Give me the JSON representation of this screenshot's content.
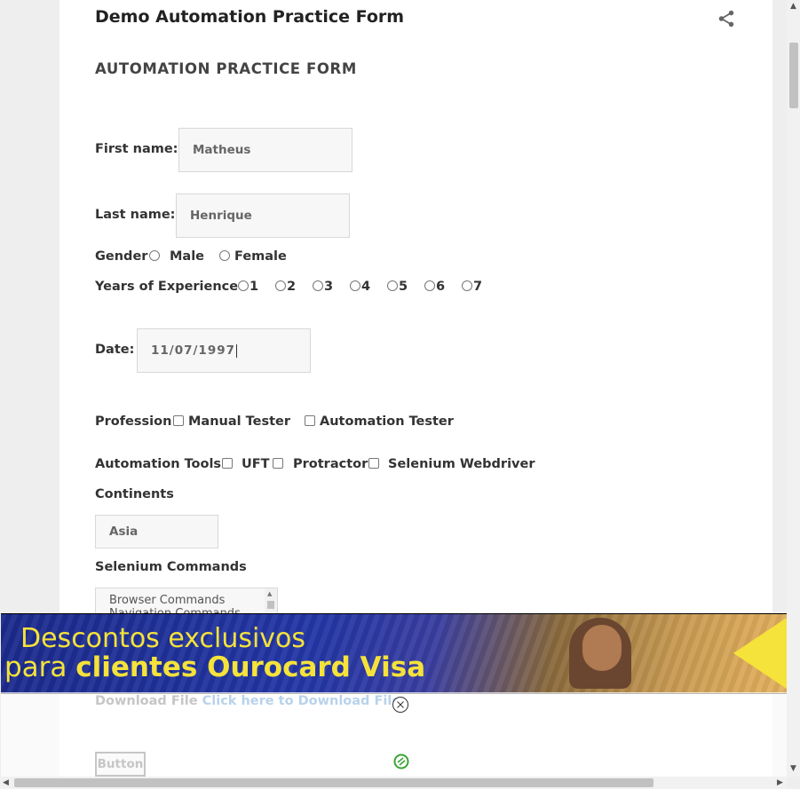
{
  "header": {
    "title": "Demo Automation Practice Form",
    "share_icon": "share-icon"
  },
  "form": {
    "heading": "AUTOMATION PRACTICE FORM",
    "first_name": {
      "label": "First name:",
      "value": "Matheus"
    },
    "last_name": {
      "label": "Last name:",
      "value": "Henrique"
    },
    "gender": {
      "label": "Gender",
      "options": [
        "Male",
        "Female"
      ]
    },
    "experience": {
      "label": "Years of Experience",
      "options": [
        "1",
        "2",
        "3",
        "4",
        "5",
        "6",
        "7"
      ]
    },
    "date": {
      "label": "Date:",
      "value": "11/07/1997"
    },
    "profession": {
      "label": "Profession",
      "options": [
        "Manual Tester",
        "Automation Tester"
      ]
    },
    "tools": {
      "label": "Automation Tools",
      "options": [
        "UFT",
        "Protractor",
        "Selenium Webdriver"
      ]
    },
    "continents": {
      "label": "Continents",
      "value": "Asia"
    },
    "selenium_commands": {
      "label": "Selenium Commands",
      "items": [
        "Browser Commands",
        "Navigation Commands"
      ]
    },
    "download": {
      "label": "Download File",
      "link": "Click here to Download File"
    },
    "button": {
      "label": "Button"
    }
  },
  "ad": {
    "line1": "Descontos exclusivos",
    "line2_prefix": "para ",
    "line2_bold": "clientes Ourocard Visa"
  },
  "scrollbars": {
    "up": "▲",
    "down": "▼",
    "left": "◀",
    "right": "▶"
  }
}
